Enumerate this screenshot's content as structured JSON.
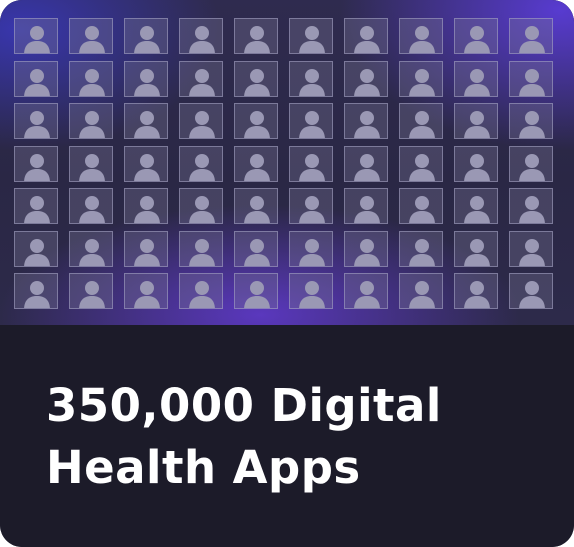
{
  "headline": {
    "line1": "350,000 Digital",
    "line2": "Health Apps"
  },
  "avatar_grid": {
    "rows": 7,
    "columns": 10,
    "icon": "person-silhouette-icon"
  },
  "colors": {
    "background": "#1c1b29",
    "grid_background": "#2a2745",
    "glow": "#623ad2",
    "tile": "#9a98b4",
    "text": "#ffffff"
  }
}
